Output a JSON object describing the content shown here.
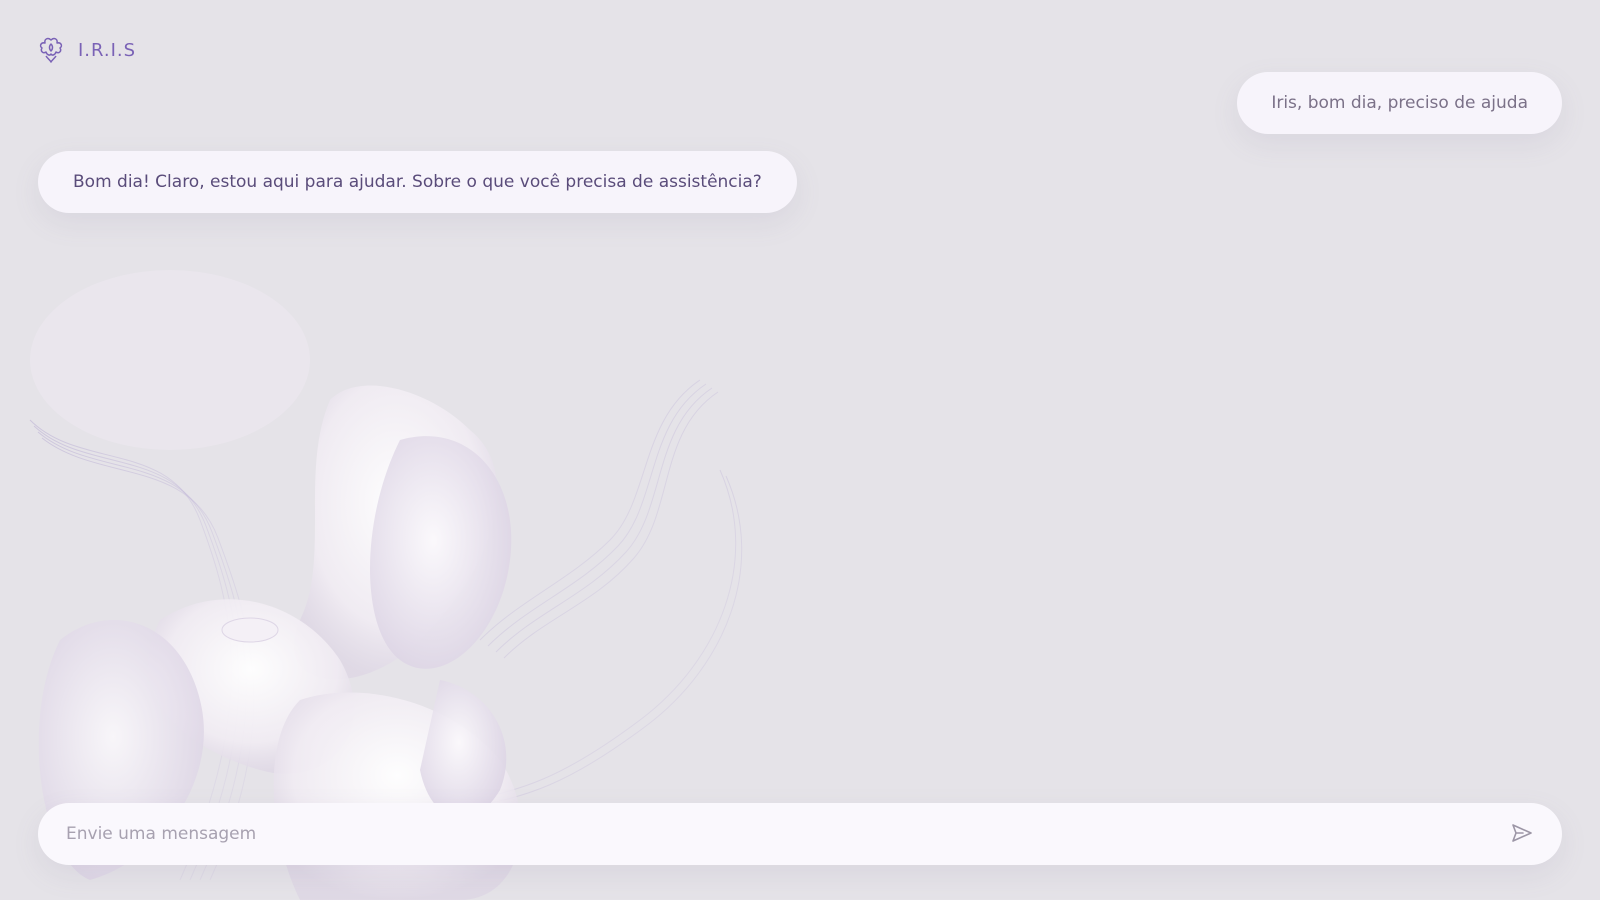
{
  "app": {
    "title": "I.R.I.S",
    "logo_icon": "flower-icon",
    "accent_color": "#7a62b6"
  },
  "messages": [
    {
      "role": "user",
      "text": "Iris, bom dia, preciso de ajuda"
    },
    {
      "role": "assistant",
      "text": "Bom dia! Claro, estou aqui para ajudar. Sobre o que você precisa de assistência?"
    }
  ],
  "composer": {
    "placeholder": "Envie uma mensagem",
    "value": "",
    "send_icon": "send-icon"
  }
}
